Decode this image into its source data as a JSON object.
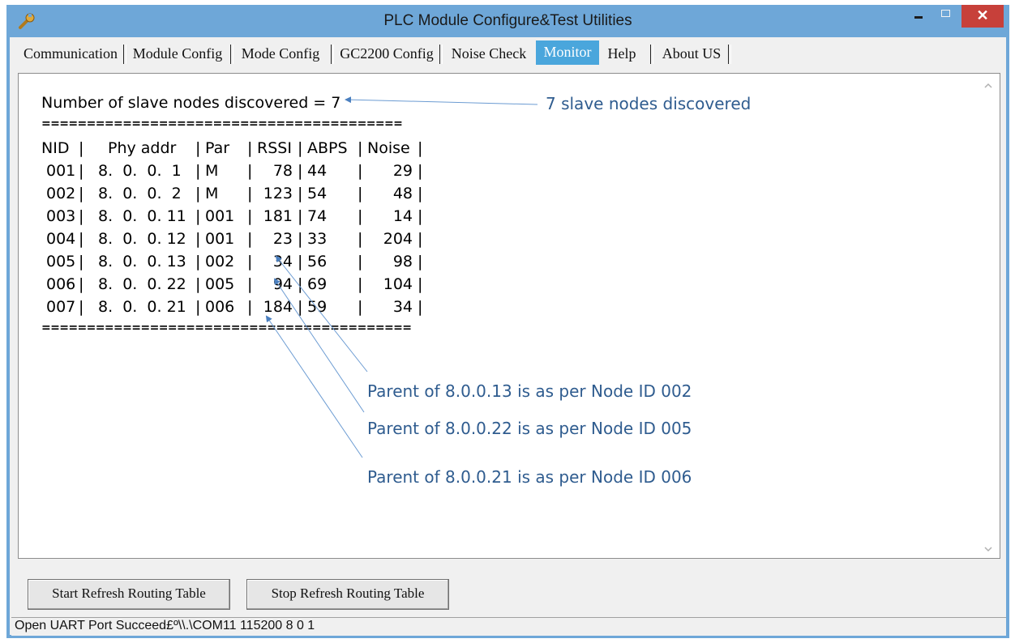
{
  "window": {
    "title": "PLC Module Configure&Test Utilities",
    "close_glyph": "✕"
  },
  "tabs": [
    {
      "label": "Communication",
      "active": false
    },
    {
      "label": "Module Config",
      "active": false
    },
    {
      "label": "Mode Config",
      "active": false
    },
    {
      "label": "GC2200 Config",
      "active": false
    },
    {
      "label": "Noise Check",
      "active": false
    },
    {
      "label": "Monitor",
      "active": true
    },
    {
      "label": "Help",
      "active": false
    },
    {
      "label": "About US",
      "active": false
    }
  ],
  "monitor": {
    "summary": "Number of slave nodes discovered = 7",
    "rule_top": "========================================",
    "rule_bottom": "=========================================",
    "table": {
      "headers": [
        "NID",
        "Phy addr",
        "Par",
        "RSSI",
        "ABPS",
        "Noise"
      ],
      "rows": [
        [
          "001",
          "8.  0.  0.  1",
          "M",
          "78",
          "44",
          "29"
        ],
        [
          "002",
          "8.  0.  0.  2",
          "M",
          "123",
          "54",
          "48"
        ],
        [
          "003",
          "8.  0.  0. 11",
          "001",
          "181",
          "74",
          "14"
        ],
        [
          "004",
          "8.  0.  0. 12",
          "001",
          "23",
          "33",
          "204"
        ],
        [
          "005",
          "8.  0.  0. 13",
          "002",
          "34",
          "56",
          "98"
        ],
        [
          "006",
          "8.  0.  0. 22",
          "005",
          "94",
          "69",
          "104"
        ],
        [
          "007",
          "8.  0.  0. 21",
          "006",
          "184",
          "59",
          "34"
        ]
      ]
    },
    "annotations": {
      "discovered": "7 slave nodes discovered",
      "parent_13": "Parent of 8.0.0.13 is as per Node ID 002",
      "parent_22": "Parent of 8.0.0.22 is as per Node ID 005",
      "parent_21": "Parent of 8.0.0.21 is as per Node ID 006"
    }
  },
  "actions": {
    "start_label": "Start Refresh Routing Table",
    "stop_label": "Stop Refresh Routing Table"
  },
  "status": {
    "text": "Open UART Port Succeed£º\\\\.\\COM11 115200 8 0 1"
  },
  "colors": {
    "frame": "#6ea7d8",
    "active_tab": "#4aa6dc",
    "annotation": "#2f5c8f",
    "close_button": "#c7403a"
  },
  "icons": {
    "app": "wrench-icon",
    "scroll_up": "chevron-up-icon",
    "scroll_down": "chevron-down-icon"
  }
}
